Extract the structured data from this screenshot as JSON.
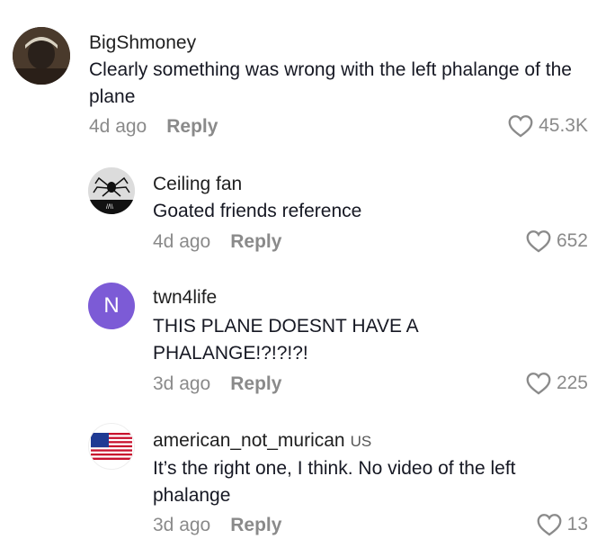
{
  "comments": [
    {
      "username": "BigShmoney",
      "text": "Clearly something was wrong with the left phalange of the plane",
      "time": "4d ago",
      "reply_label": "Reply",
      "likes": "45.3K",
      "avatar_icon": "photo-avatar"
    },
    {
      "username": "Ceiling fan",
      "text": "Goated friends reference",
      "time": "4d ago",
      "reply_label": "Reply",
      "likes": "652",
      "avatar_icon": "spider-photo-avatar"
    },
    {
      "username": "twn4life",
      "text": "THIS PLANE DOESNT HAVE A PHALANGE!?!?!?!",
      "time": "3d ago",
      "reply_label": "Reply",
      "likes": "225",
      "avatar_letter": "N",
      "avatar_color": "#7c5bd6"
    },
    {
      "username": "american_not_murican",
      "country_tag": "US",
      "text": "It’s the right one, I think. No video of the left phalange",
      "time": "3d ago",
      "reply_label": "Reply",
      "likes": "13",
      "avatar_icon": "us-flag-avatar"
    }
  ],
  "colors": {
    "muted": "#8a8a8a",
    "text": "#161823"
  }
}
